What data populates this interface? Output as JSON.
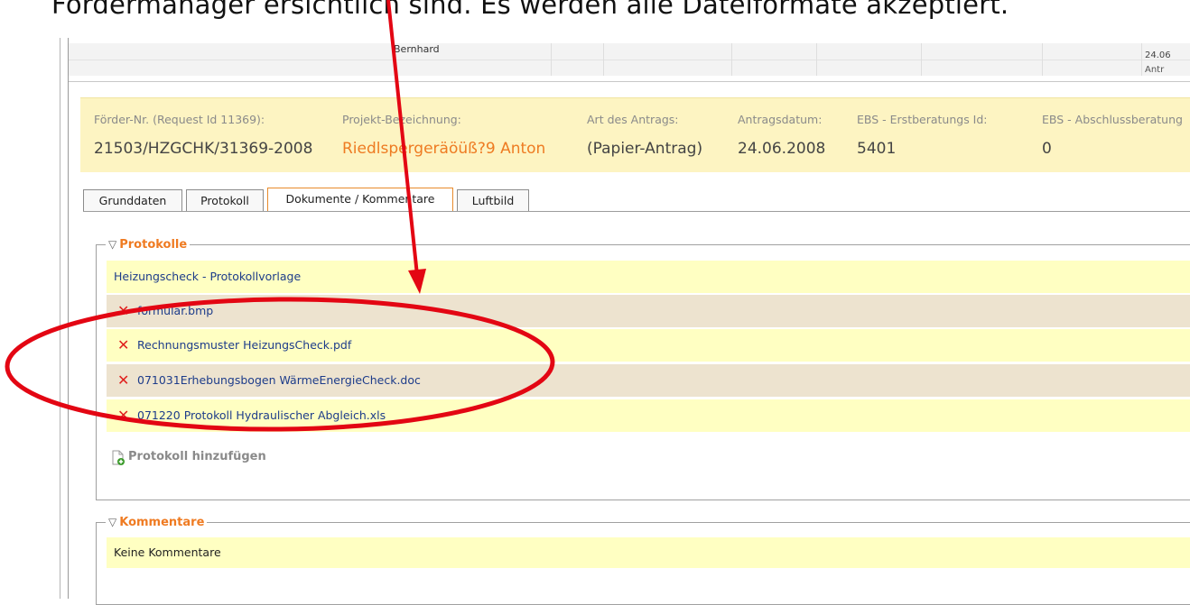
{
  "caption": "Fördermanager ersichtlich sind. Es werden alle Dateiformate akzeptiert.",
  "background_list": {
    "name_fragment": "Bernhard",
    "date_fragment": "24.06",
    "status_fragment": "Antr"
  },
  "header": {
    "columns": [
      {
        "label": "Förder-Nr. (Request Id 11369):",
        "value": "21503/HZGCHK/31369-2008"
      },
      {
        "label": "Projekt-Bezeichnung:",
        "value": "Riedlspergeräöüß?9 Anton"
      },
      {
        "label": "Art des Antrags:",
        "value": "(Papier-Antrag)"
      },
      {
        "label": "Antragsdatum:",
        "value": "24.06.2008"
      },
      {
        "label": "EBS - Erstberatungs Id:",
        "value": "5401"
      },
      {
        "label": "EBS - Abschlussberatung",
        "value": "0"
      }
    ]
  },
  "tabs": [
    {
      "label": "Grunddaten",
      "active": false
    },
    {
      "label": "Protokoll",
      "active": false
    },
    {
      "label": "Dokumente / Kommentare",
      "active": true
    },
    {
      "label": "Luftbild",
      "active": false
    }
  ],
  "protokolle": {
    "legend": "Protokolle",
    "template_row": "Heizungscheck - Protokollvorlage",
    "files": [
      "formular.bmp",
      "Rechnungsmuster HeizungsCheck.pdf",
      "071031Erhebungsbogen WärmeEnergieCheck.doc",
      "071220 Protokoll Hydraulischer Abgleich.xls"
    ],
    "add_label": "Protokoll hinzufügen"
  },
  "kommentare": {
    "legend": "Kommentare",
    "empty_text": "Keine Kommentare"
  },
  "icons": {
    "delete": "close-x-icon",
    "add": "add-document-icon",
    "collapse": "collapse-triangle-icon"
  },
  "colors": {
    "header_bg": "#fdf4c2",
    "accent_orange": "#ef7b22",
    "row_yellow": "#ffffc2",
    "row_beige": "#ede3cf",
    "delete_red": "#e0201d",
    "annotation_red": "#e30613",
    "link_blue": "#1d3c8a"
  }
}
